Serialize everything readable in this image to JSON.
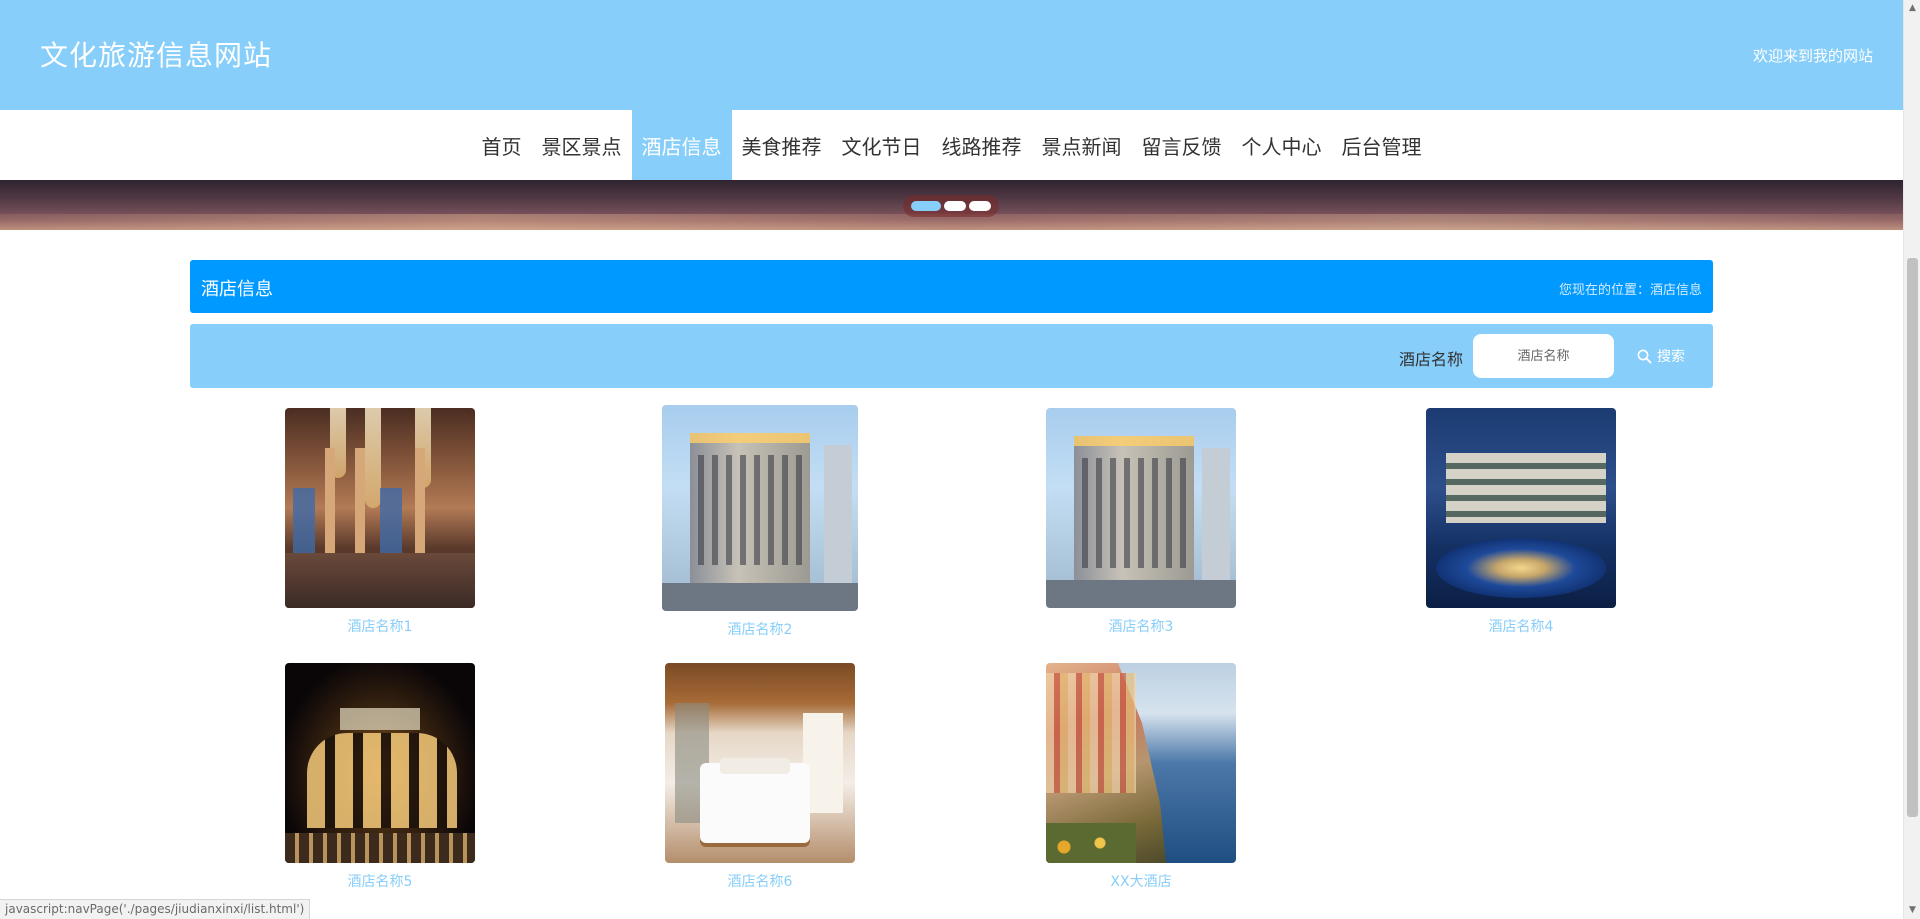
{
  "header": {
    "site_title": "文化旅游信息网站",
    "welcome": "欢迎来到我的网站",
    "bg_color": "#87cefa"
  },
  "nav": {
    "items": [
      {
        "label": "首页",
        "active": false
      },
      {
        "label": "景区景点",
        "active": false
      },
      {
        "label": "酒店信息",
        "active": true
      },
      {
        "label": "美食推荐",
        "active": false
      },
      {
        "label": "文化节日",
        "active": false
      },
      {
        "label": "线路推荐",
        "active": false
      },
      {
        "label": "景点新闻",
        "active": false
      },
      {
        "label": "留言反馈",
        "active": false
      },
      {
        "label": "个人中心",
        "active": false
      },
      {
        "label": "后台管理",
        "active": false
      }
    ]
  },
  "banner": {
    "slides": 3,
    "active_slide": 1
  },
  "section": {
    "title": "酒店信息",
    "breadcrumb_prefix": "您现在的位置：",
    "breadcrumb_current": "酒店信息",
    "title_bg": "#0099ff"
  },
  "search": {
    "label": "酒店名称",
    "placeholder": "酒店名称",
    "value": "",
    "button_label": "搜索",
    "button_icon": "search-icon"
  },
  "hotels": [
    {
      "name": "酒店名称1",
      "image": "hotel-lobby-image"
    },
    {
      "name": "酒店名称2",
      "image": "hotel-building-image"
    },
    {
      "name": "酒店名称3",
      "image": "hotel-building-image"
    },
    {
      "name": "酒店名称4",
      "image": "resort-night-image"
    },
    {
      "name": "酒店名称5",
      "image": "hotel-night-facade-image"
    },
    {
      "name": "酒店名称6",
      "image": "hotel-room-image"
    },
    {
      "name": "XX大酒店",
      "image": "coastal-village-image"
    }
  ],
  "statusbar": {
    "text": "javascript:navPage('./pages/jiudianxinxi/list.html')"
  },
  "colors": {
    "accent_light": "#87cefa",
    "accent_dark": "#0099ff",
    "card_name": "#87cefa"
  }
}
